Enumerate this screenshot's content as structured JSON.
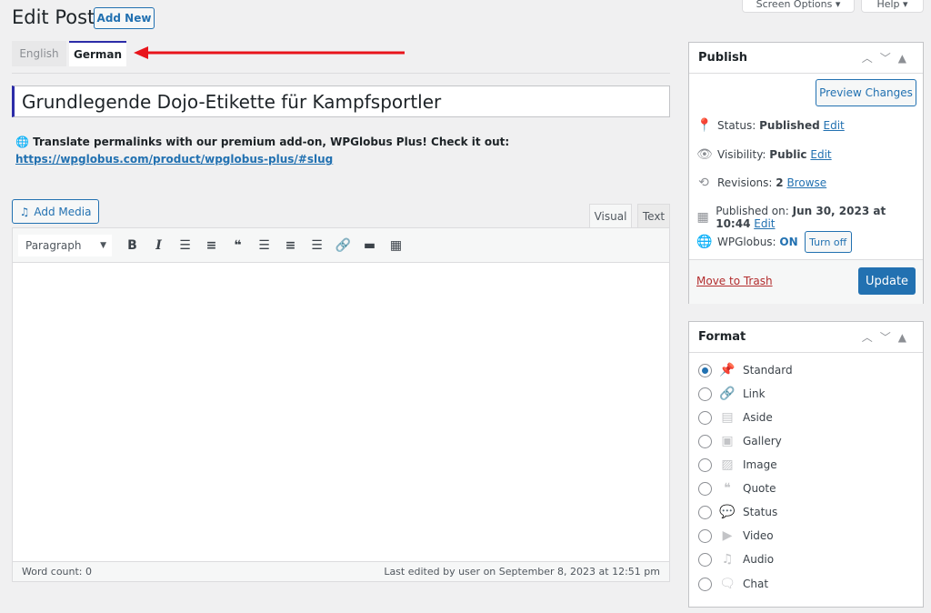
{
  "header": {
    "title": "Edit Post",
    "add_new": "Add New",
    "screen_options": "Screen Options ▾",
    "help": "Help ▾"
  },
  "language_tabs": [
    {
      "label": "English",
      "active": false
    },
    {
      "label": "German",
      "active": true
    }
  ],
  "post_title": "Grundlegende Dojo-Etikette für Kampfsportler",
  "notice": {
    "text": "Translate permalinks with our premium add-on, WPGlobus Plus! Check it out: ",
    "link": "https://wpglobus.com/product/wpglobus-plus/#slug"
  },
  "editor": {
    "add_media": "Add Media",
    "tab_visual": "Visual",
    "tab_text": "Text",
    "format_select": "Paragraph",
    "word_count": "Word count: 0",
    "last_edited": "Last edited by user on September 8, 2023 at 12:51 pm"
  },
  "publish": {
    "title": "Publish",
    "preview": "Preview Changes",
    "status_label": "Status: ",
    "status_value": "Published",
    "status_edit": "Edit",
    "visibility_label": "Visibility: ",
    "visibility_value": "Public",
    "visibility_edit": "Edit",
    "revisions_label": "Revisions: ",
    "revisions_value": "2",
    "revisions_browse": "Browse",
    "published_label": "Published on: ",
    "published_value": "Jun 30, 2023 at 10:44",
    "published_edit": "Edit",
    "wpglobus_label": "WPGlobus: ",
    "wpglobus_value": "ON",
    "turn_off": "Turn off",
    "trash": "Move to Trash",
    "update": "Update"
  },
  "format": {
    "title": "Format",
    "selected": "Standard",
    "options": [
      "Standard",
      "Link",
      "Aside",
      "Gallery",
      "Image",
      "Quote",
      "Status",
      "Video",
      "Audio",
      "Chat"
    ]
  },
  "colors": {
    "accent": "#2271b1",
    "tab_indicator": "#2c2ca8",
    "annotation_arrow": "#e8141b",
    "trash": "#b32d2e"
  }
}
